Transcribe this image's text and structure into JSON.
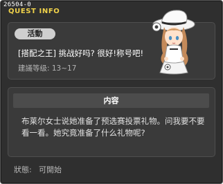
{
  "window": {
    "quest_id": "26504-0",
    "title": "QUEST INFO"
  },
  "quest": {
    "category_tab": "活動",
    "name": "[搭配之王] 挑战好吗? 很好!称号吧!",
    "recommended_level": "建議等级: 13~17"
  },
  "content": {
    "header": "内容",
    "text": "布莱尔女士说她准备了预选赛投票礼物。问我要不要看一看。她究竟准备了什么礼物呢?"
  },
  "status": {
    "label": "狀態:",
    "value": "可開始"
  },
  "npc": {
    "icon": "npc-lady-portrait"
  },
  "colors": {
    "window_bg": "#2f2f2f",
    "panel_bg": "#3a3a3a",
    "title_yellow": "#f0d24a",
    "tab_bg": "#cfcfcf",
    "content_header_bg": "#4c4c4c"
  }
}
